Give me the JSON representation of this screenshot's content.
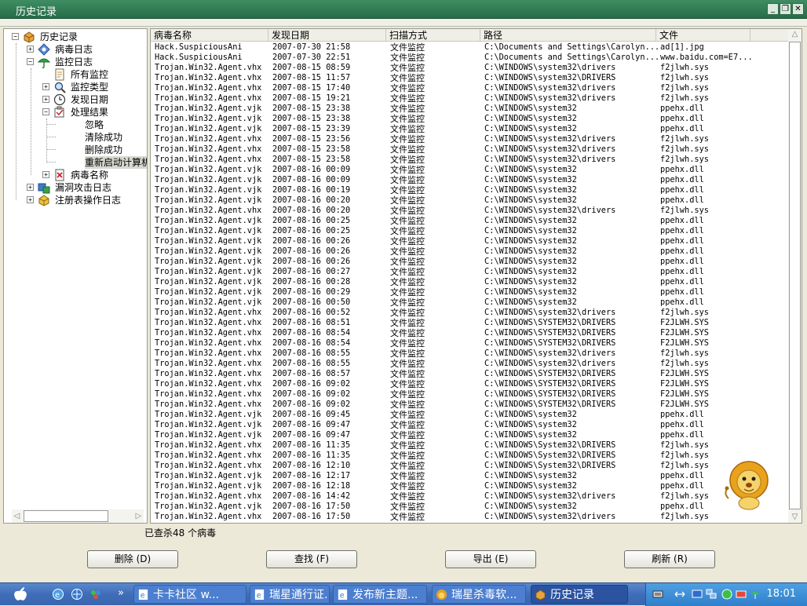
{
  "window": {
    "title": "历史记录"
  },
  "tree": {
    "root": "历史记录",
    "virus_log": "病毒日志",
    "monitor_log": "监控日志",
    "all_monitor": "所有监控",
    "monitor_type": "监控类型",
    "discover_date": "发现日期",
    "process_result": "处理结果",
    "ignore": "忽略",
    "clear_success": "清除成功",
    "delete_success": "删除成功",
    "reboot_calc": "重新启动计算机",
    "virus_name": "病毒名称",
    "exploit_log": "漏洞攻击日志",
    "registry_log": "注册表操作日志"
  },
  "table": {
    "columns": [
      "病毒名称",
      "发现日期",
      "扫描方式",
      "路径",
      "文件"
    ],
    "rows": [
      [
        "Hack.SuspiciousAni",
        "2007-07-30 21:58",
        "文件监控",
        "C:\\Documents and Settings\\Carolyn...",
        "ad[1].jpg"
      ],
      [
        "Hack.SuspiciousAni",
        "2007-07-30 22:51",
        "文件监控",
        "C:\\Documents and Settings\\Carolyn...",
        "www.baidu.com=E7..."
      ],
      [
        "Trojan.Win32.Agent.vhx",
        "2007-08-15 08:59",
        "文件监控",
        "C:\\WINDOWS\\system32\\drivers",
        "f2jlwh.sys"
      ],
      [
        "Trojan.Win32.Agent.vhx",
        "2007-08-15 11:57",
        "文件监控",
        "C:\\WINDOWS\\system32\\DRIVERS",
        "f2jlwh.sys"
      ],
      [
        "Trojan.Win32.Agent.vhx",
        "2007-08-15 17:40",
        "文件监控",
        "C:\\WINDOWS\\system32\\drivers",
        "f2jlwh.sys"
      ],
      [
        "Trojan.Win32.Agent.vhx",
        "2007-08-15 19:21",
        "文件监控",
        "C:\\WINDOWS\\system32\\drivers",
        "f2jlwh.sys"
      ],
      [
        "Trojan.Win32.Agent.vjk",
        "2007-08-15 23:38",
        "文件监控",
        "C:\\WINDOWS\\system32",
        "ppehx.dll"
      ],
      [
        "Trojan.Win32.Agent.vjk",
        "2007-08-15 23:38",
        "文件监控",
        "C:\\WINDOWS\\system32",
        "ppehx.dll"
      ],
      [
        "Trojan.Win32.Agent.vjk",
        "2007-08-15 23:39",
        "文件监控",
        "C:\\WINDOWS\\system32",
        "ppehx.dll"
      ],
      [
        "Trojan.Win32.Agent.vhx",
        "2007-08-15 23:56",
        "文件监控",
        "C:\\WINDOWS\\system32\\drivers",
        "f2jlwh.sys"
      ],
      [
        "Trojan.Win32.Agent.vhx",
        "2007-08-15 23:58",
        "文件监控",
        "C:\\WINDOWS\\system32\\drivers",
        "f2jlwh.sys"
      ],
      [
        "Trojan.Win32.Agent.vhx",
        "2007-08-15 23:58",
        "文件监控",
        "C:\\WINDOWS\\system32\\drivers",
        "f2jlwh.sys"
      ],
      [
        "Trojan.Win32.Agent.vjk",
        "2007-08-16 00:09",
        "文件监控",
        "C:\\WINDOWS\\system32",
        "ppehx.dll"
      ],
      [
        "Trojan.Win32.Agent.vjk",
        "2007-08-16 00:09",
        "文件监控",
        "C:\\WINDOWS\\system32",
        "ppehx.dll"
      ],
      [
        "Trojan.Win32.Agent.vjk",
        "2007-08-16 00:19",
        "文件监控",
        "C:\\WINDOWS\\system32",
        "ppehx.dll"
      ],
      [
        "Trojan.Win32.Agent.vjk",
        "2007-08-16 00:20",
        "文件监控",
        "C:\\WINDOWS\\system32",
        "ppehx.dll"
      ],
      [
        "Trojan.Win32.Agent.vhx",
        "2007-08-16 00:20",
        "文件监控",
        "C:\\WINDOWS\\system32\\drivers",
        "f2jlwh.sys"
      ],
      [
        "Trojan.Win32.Agent.vjk",
        "2007-08-16 00:25",
        "文件监控",
        "C:\\WINDOWS\\system32",
        "ppehx.dll"
      ],
      [
        "Trojan.Win32.Agent.vjk",
        "2007-08-16 00:25",
        "文件监控",
        "C:\\WINDOWS\\system32",
        "ppehx.dll"
      ],
      [
        "Trojan.Win32.Agent.vjk",
        "2007-08-16 00:26",
        "文件监控",
        "C:\\WINDOWS\\system32",
        "ppehx.dll"
      ],
      [
        "Trojan.Win32.Agent.vjk",
        "2007-08-16 00:26",
        "文件监控",
        "C:\\WINDOWS\\system32",
        "ppehx.dll"
      ],
      [
        "Trojan.Win32.Agent.vjk",
        "2007-08-16 00:26",
        "文件监控",
        "C:\\WINDOWS\\system32",
        "ppehx.dll"
      ],
      [
        "Trojan.Win32.Agent.vjk",
        "2007-08-16 00:27",
        "文件监控",
        "C:\\WINDOWS\\system32",
        "ppehx.dll"
      ],
      [
        "Trojan.Win32.Agent.vjk",
        "2007-08-16 00:28",
        "文件监控",
        "C:\\WINDOWS\\system32",
        "ppehx.dll"
      ],
      [
        "Trojan.Win32.Agent.vjk",
        "2007-08-16 00:29",
        "文件监控",
        "C:\\WINDOWS\\system32",
        "ppehx.dll"
      ],
      [
        "Trojan.Win32.Agent.vjk",
        "2007-08-16 00:50",
        "文件监控",
        "C:\\WINDOWS\\system32",
        "ppehx.dll"
      ],
      [
        "Trojan.Win32.Agent.vhx",
        "2007-08-16 00:52",
        "文件监控",
        "C:\\WINDOWS\\system32\\drivers",
        "f2jlwh.sys"
      ],
      [
        "Trojan.Win32.Agent.vhx",
        "2007-08-16 08:51",
        "文件监控",
        "C:\\WINDOWS\\SYSTEM32\\DRIVERS",
        "F2JLWH.SYS"
      ],
      [
        "Trojan.Win32.Agent.vhx",
        "2007-08-16 08:54",
        "文件监控",
        "C:\\WINDOWS\\SYSTEM32\\DRIVERS",
        "F2JLWH.SYS"
      ],
      [
        "Trojan.Win32.Agent.vhx",
        "2007-08-16 08:54",
        "文件监控",
        "C:\\WINDOWS\\SYSTEM32\\DRIVERS",
        "F2JLWH.SYS"
      ],
      [
        "Trojan.Win32.Agent.vhx",
        "2007-08-16 08:55",
        "文件监控",
        "C:\\WINDOWS\\system32\\drivers",
        "f2jlwh.sys"
      ],
      [
        "Trojan.Win32.Agent.vhx",
        "2007-08-16 08:55",
        "文件监控",
        "C:\\WINDOWS\\system32\\drivers",
        "f2jlwh.sys"
      ],
      [
        "Trojan.Win32.Agent.vhx",
        "2007-08-16 08:57",
        "文件监控",
        "C:\\WINDOWS\\SYSTEM32\\DRIVERS",
        "F2JLWH.SYS"
      ],
      [
        "Trojan.Win32.Agent.vhx",
        "2007-08-16 09:02",
        "文件监控",
        "C:\\WINDOWS\\SYSTEM32\\DRIVERS",
        "F2JLWH.SYS"
      ],
      [
        "Trojan.Win32.Agent.vhx",
        "2007-08-16 09:02",
        "文件监控",
        "C:\\WINDOWS\\SYSTEM32\\DRIVERS",
        "F2JLWH.SYS"
      ],
      [
        "Trojan.Win32.Agent.vhx",
        "2007-08-16 09:02",
        "文件监控",
        "C:\\WINDOWS\\SYSTEM32\\DRIVERS",
        "F2JLWH.SYS"
      ],
      [
        "Trojan.Win32.Agent.vjk",
        "2007-08-16 09:45",
        "文件监控",
        "C:\\WINDOWS\\system32",
        "ppehx.dll"
      ],
      [
        "Trojan.Win32.Agent.vjk",
        "2007-08-16 09:47",
        "文件监控",
        "C:\\WINDOWS\\system32",
        "ppehx.dll"
      ],
      [
        "Trojan.Win32.Agent.vjk",
        "2007-08-16 09:47",
        "文件监控",
        "C:\\WINDOWS\\system32",
        "ppehx.dll"
      ],
      [
        "Trojan.Win32.Agent.vhx",
        "2007-08-16 11:35",
        "文件监控",
        "C:\\WINDOWS\\System32\\DRIVERS",
        "f2jlwh.sys"
      ],
      [
        "Trojan.Win32.Agent.vhx",
        "2007-08-16 11:35",
        "文件监控",
        "C:\\WINDOWS\\System32\\DRIVERS",
        "f2jlwh.sys"
      ],
      [
        "Trojan.Win32.Agent.vhx",
        "2007-08-16 12:10",
        "文件监控",
        "C:\\WINDOWS\\System32\\DRIVERS",
        "f2jlwh.sys"
      ],
      [
        "Trojan.Win32.Agent.vjk",
        "2007-08-16 12:17",
        "文件监控",
        "C:\\WINDOWS\\system32",
        "ppehx.dll"
      ],
      [
        "Trojan.Win32.Agent.vjk",
        "2007-08-16 12:18",
        "文件监控",
        "C:\\WINDOWS\\system32",
        "ppehx.dll"
      ],
      [
        "Trojan.Win32.Agent.vhx",
        "2007-08-16 14:42",
        "文件监控",
        "C:\\WINDOWS\\system32\\drivers",
        "f2jlwh.sys"
      ],
      [
        "Trojan.Win32.Agent.vjk",
        "2007-08-16 17:50",
        "文件监控",
        "C:\\WINDOWS\\system32",
        "ppehx.dll"
      ],
      [
        "Trojan.Win32.Agent.vhx",
        "2007-08-16 17:50",
        "文件监控",
        "C:\\WINDOWS\\system32\\drivers",
        "f2jlwh.sys"
      ]
    ]
  },
  "status": {
    "text": "已查杀48 个病毒"
  },
  "buttons": {
    "delete": "删除 (D)",
    "find": "查找 (F)",
    "export": "导出 (E)",
    "refresh": "刷新 (R)"
  },
  "taskbar": {
    "chevron": "»",
    "tasks": [
      "卡卡社区 w...",
      "瑞星通行证...",
      "发布新主题...",
      "瑞星杀毒软...",
      "历史记录"
    ],
    "clock": "18:01"
  },
  "colors": {
    "titlebar": "#2f7a52",
    "taskbar": "#3f6db8",
    "active_task": "#2b53a0"
  }
}
